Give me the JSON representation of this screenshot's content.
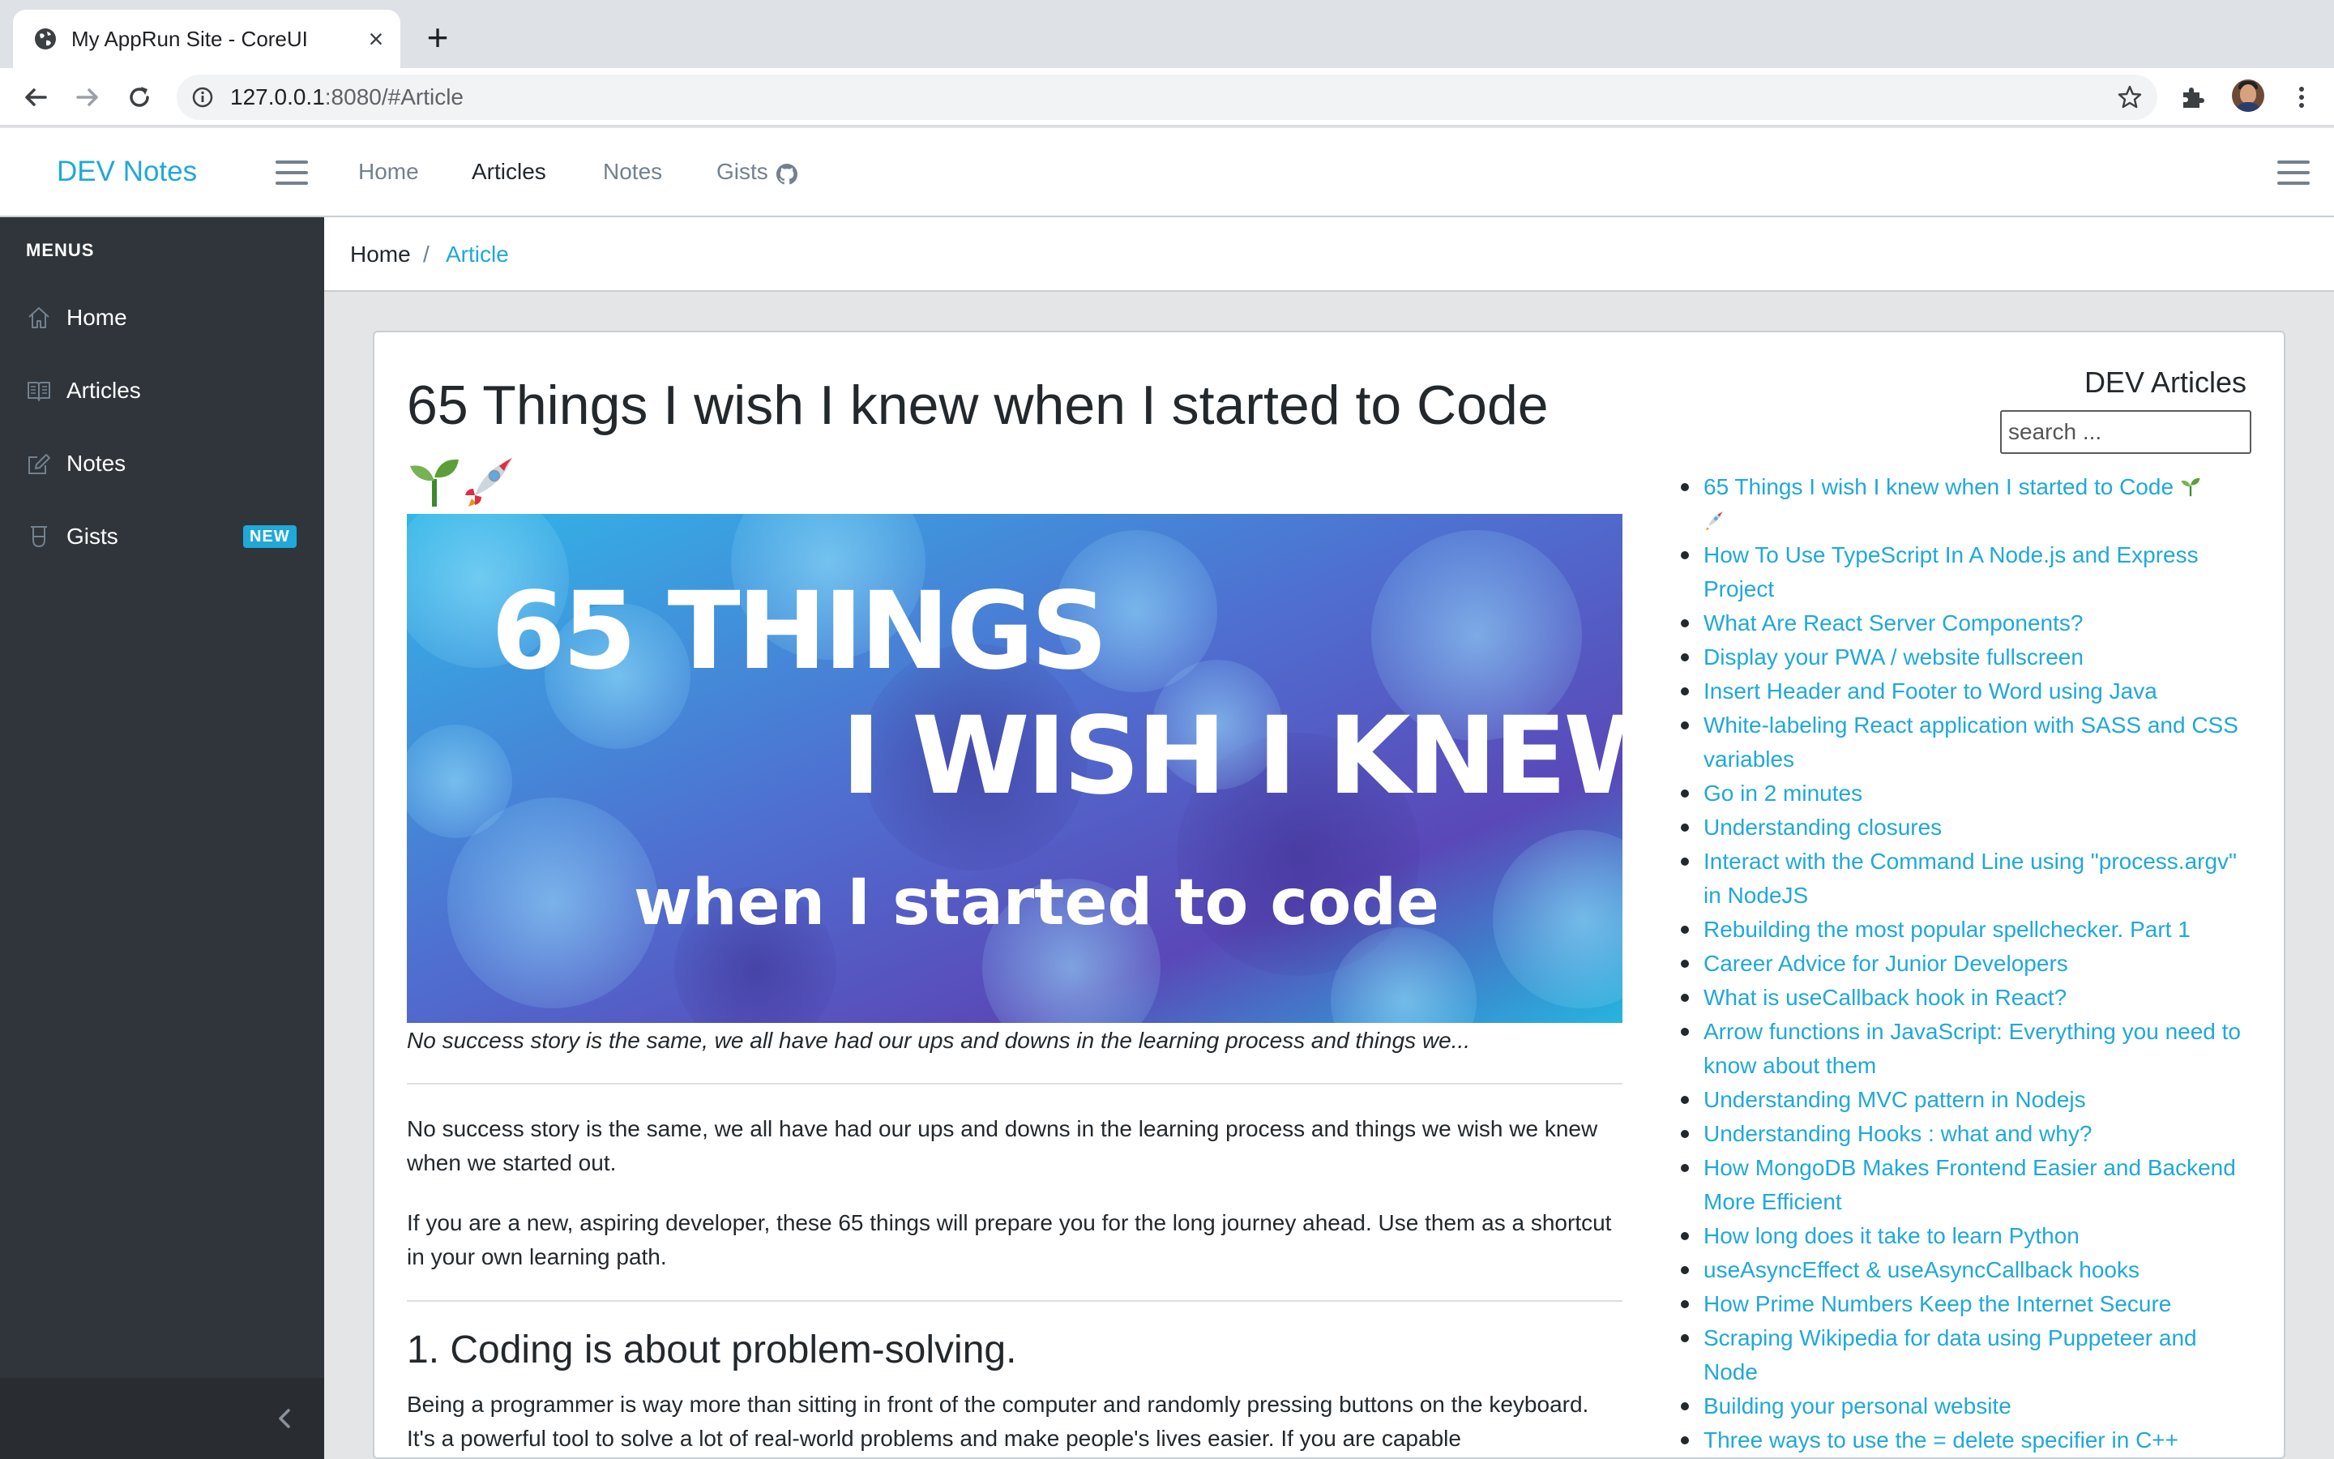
{
  "browser": {
    "tab_title": "My AppRun Site - CoreUI",
    "url_host": "127.0.0.1",
    "url_path": ":8080/#Article"
  },
  "header": {
    "brand": "DEV Notes",
    "nav": [
      "Home",
      "Articles",
      "Notes",
      "Gists"
    ],
    "active_nav": "Articles"
  },
  "sidebar": {
    "title": "MENUS",
    "items": [
      {
        "label": "Home",
        "icon": "home-icon"
      },
      {
        "label": "Articles",
        "icon": "book-icon"
      },
      {
        "label": "Notes",
        "icon": "pencil-square-icon"
      },
      {
        "label": "Gists",
        "icon": "beaker-icon",
        "badge": "NEW"
      }
    ]
  },
  "breadcrumb": {
    "home": "Home",
    "separator": "/",
    "current": "Article"
  },
  "article": {
    "title": "65 Things I wish I knew when I started to Code",
    "hero_line1": "65 THINGS",
    "hero_line2": "I WISH I KNEW",
    "hero_line3": "when I started to code",
    "caption": "No success story is the same, we all have had our ups and downs in the learning process and things we...",
    "para1": "No success story is the same, we all have had our ups and downs in the learning process and things we wish we knew when we started out.",
    "para2": "If you are a new, aspiring developer, these 65 things will prepare you for the long journey ahead. Use them as a shortcut in your own learning path.",
    "section1_title": "1. Coding is about problem-solving.",
    "section1_text": "Being a programmer is way more than sitting in front of the computer and randomly pressing buttons on the keyboard. It's a powerful tool to solve a lot of real-world problems and make people's lives easier. If you are capable"
  },
  "dev_articles": {
    "title": "DEV Articles",
    "search_placeholder": "search ...",
    "items": [
      "65 Things I wish I knew when I started to Code",
      "How To Use TypeScript In A Node.js and Express Project",
      "What Are React Server Components?",
      "Display your PWA / website fullscreen",
      "Insert Header and Footer to Word using Java",
      "White-labeling React application with SASS and CSS variables",
      "Go in 2 minutes",
      "Understanding closures",
      "Interact with the Command Line using \"process.argv\" in NodeJS",
      "Rebuilding the most popular spellchecker. Part 1",
      "Career Advice for Junior Developers",
      "What is useCallback hook in React?",
      "Arrow functions in JavaScript: Everything you need to know about them",
      "Understanding MVC pattern in Nodejs",
      "Understanding Hooks : what and why?",
      "How MongoDB Makes Frontend Easier and Backend More Efficient",
      "How long does it take to learn Python",
      "useAsyncEffect & useAsyncCallback hooks",
      "How Prime Numbers Keep the Internet Secure",
      "Scraping Wikipedia for data using Puppeteer and Node",
      "Building your personal website",
      "Three ways to use the = delete specifier in C++"
    ]
  },
  "colors": {
    "accent": "#20a8d8",
    "sidebar_bg": "#2f353a",
    "text": "#23282c",
    "muted": "#73818f"
  }
}
